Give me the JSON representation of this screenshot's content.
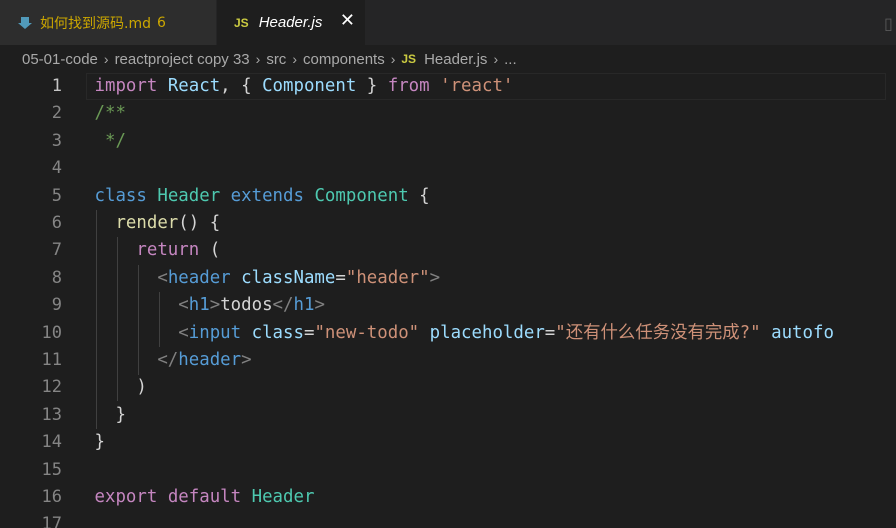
{
  "tabs": [
    {
      "label": "如何找到源码.md",
      "badge": "6",
      "icon": "markdown-icon",
      "color": "#cca700"
    },
    {
      "label": "Header.js",
      "icon": "js-icon",
      "active": true
    }
  ],
  "breadcrumb": {
    "items": [
      "05-01-code",
      "reactproject copy 33",
      "src",
      "components",
      "Header.js",
      "..."
    ],
    "file_icon": "JS"
  },
  "editor": {
    "active_line": 1,
    "lines": [
      {
        "n": "1"
      },
      {
        "n": "2"
      },
      {
        "n": "3"
      },
      {
        "n": "4"
      },
      {
        "n": "5"
      },
      {
        "n": "6"
      },
      {
        "n": "7"
      },
      {
        "n": "8"
      },
      {
        "n": "9"
      },
      {
        "n": "10"
      },
      {
        "n": "11"
      },
      {
        "n": "12"
      },
      {
        "n": "13"
      },
      {
        "n": "14"
      },
      {
        "n": "15"
      },
      {
        "n": "16"
      },
      {
        "n": "17"
      }
    ],
    "tokens": {
      "l1": [
        "import",
        " ",
        "React",
        ", { ",
        "Component",
        " } ",
        "from",
        " ",
        "'react'"
      ],
      "l2": [
        "/**"
      ],
      "l3": [
        " */"
      ],
      "l5": [
        "class",
        " ",
        "Header",
        " ",
        "extends",
        " ",
        "Component",
        " {"
      ],
      "l6": [
        "  ",
        "render",
        "() {"
      ],
      "l7": [
        "    ",
        "return",
        " ("
      ],
      "l8": [
        "      ",
        "<",
        "header",
        " ",
        "className",
        "=",
        "\"header\"",
        ">"
      ],
      "l9": [
        "        ",
        "<",
        "h1",
        ">",
        "todos",
        "</",
        "h1",
        ">"
      ],
      "l10": [
        "        ",
        "<",
        "input",
        " ",
        "class",
        "=",
        "\"new-todo\"",
        " ",
        "placeholder",
        "=",
        "\"还有什么任务没有完成?\"",
        " ",
        "autofo"
      ],
      "l11": [
        "      ",
        "</",
        "header",
        ">"
      ],
      "l12": [
        "    )"
      ],
      "l13": [
        "  }"
      ],
      "l14": [
        "}"
      ],
      "l16": [
        "export",
        " ",
        "default",
        " ",
        "Header"
      ]
    }
  }
}
